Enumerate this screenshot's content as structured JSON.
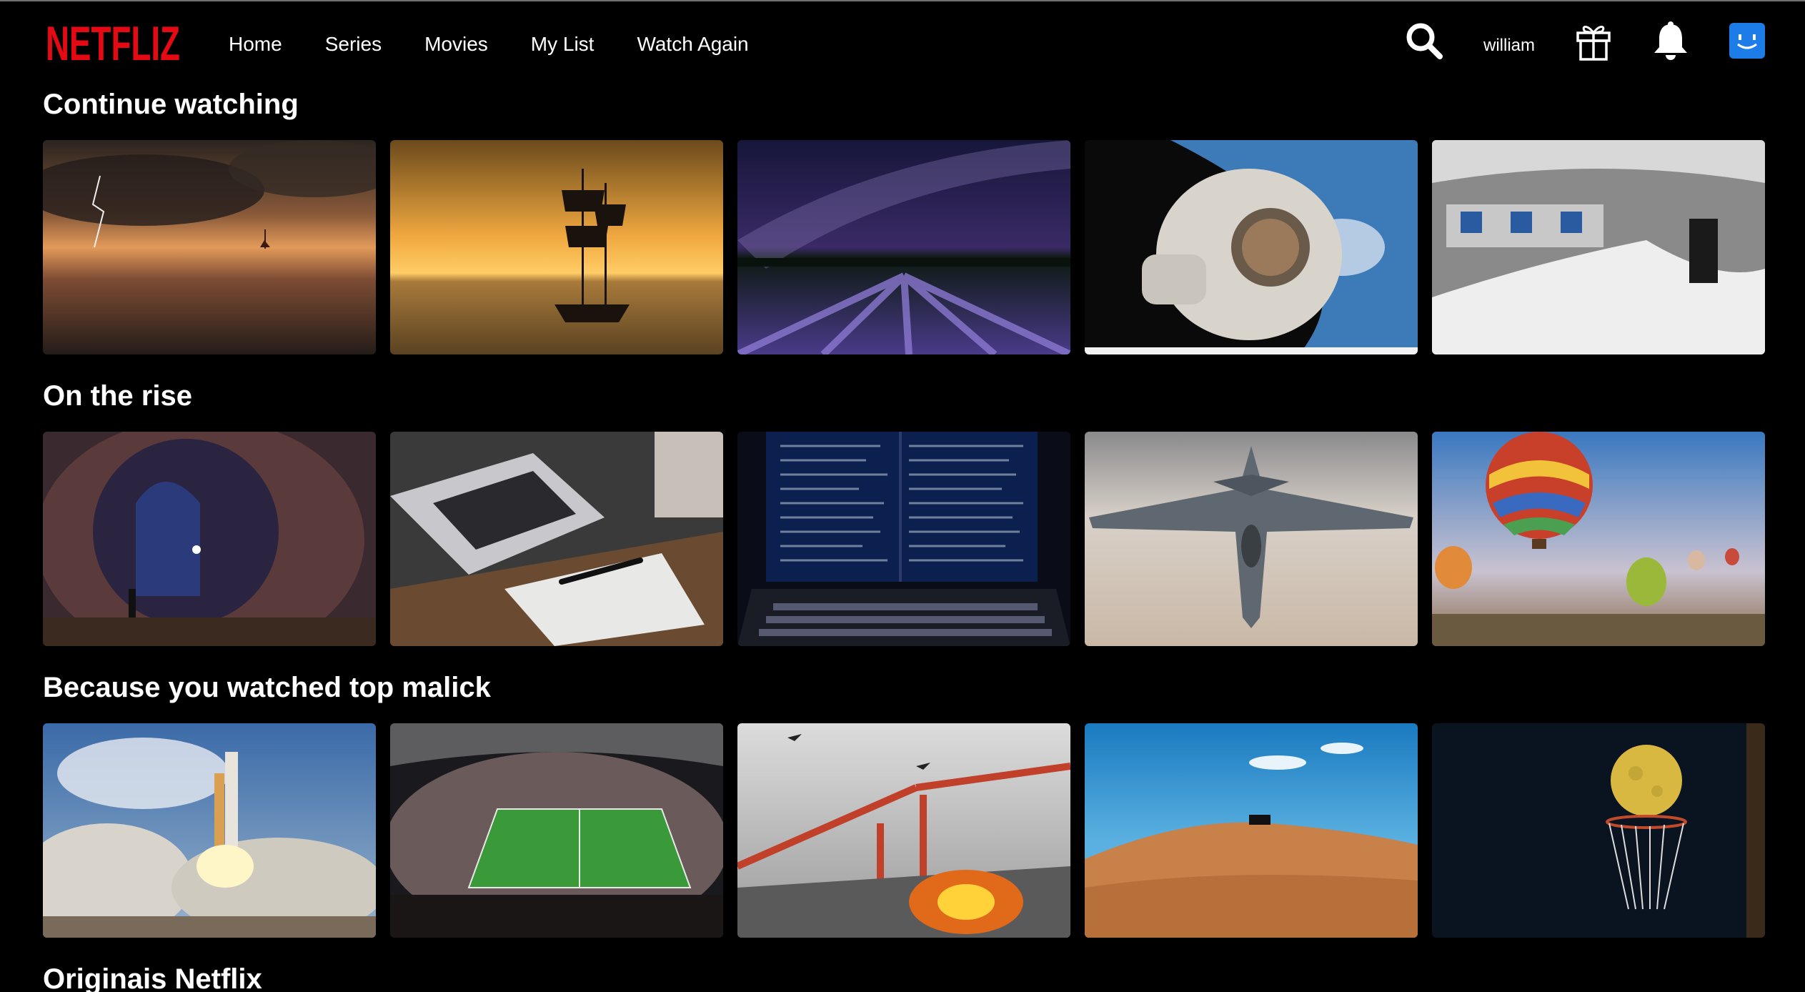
{
  "app": {
    "logo_text": "NETFLIZ",
    "brand_color": "#e50914"
  },
  "nav": {
    "items": [
      {
        "label": "Home"
      },
      {
        "label": "Series"
      },
      {
        "label": "Movies"
      },
      {
        "label": "My List"
      },
      {
        "label": "Watch Again"
      }
    ]
  },
  "header": {
    "username": "william",
    "icons": [
      "search-icon",
      "gift-icon",
      "bell-icon",
      "avatar"
    ],
    "avatar_color": "#1d7de8"
  },
  "rows": [
    {
      "title": "Continue watching",
      "tiles": [
        {
          "subject": "storm-sunset-sailboat"
        },
        {
          "subject": "tall-ship-sunset"
        },
        {
          "subject": "milky-way-lavender-field"
        },
        {
          "subject": "astronaut-space"
        },
        {
          "subject": "flooded-metro-station"
        }
      ]
    },
    {
      "title": "On the rise",
      "tiles": [
        {
          "subject": "cave-window"
        },
        {
          "subject": "laptop-notebook"
        },
        {
          "subject": "laptop-code"
        },
        {
          "subject": "fighter-jet"
        },
        {
          "subject": "hot-air-balloons"
        }
      ]
    },
    {
      "title": "Because you watched top malick",
      "tiles": [
        {
          "subject": "shuttle-launch"
        },
        {
          "subject": "football-stadium"
        },
        {
          "subject": "bridge-battle"
        },
        {
          "subject": "desert-dune-car"
        },
        {
          "subject": "moon-basketball-hoop"
        }
      ]
    },
    {
      "title": "Originais Netflix",
      "tiles": []
    }
  ]
}
